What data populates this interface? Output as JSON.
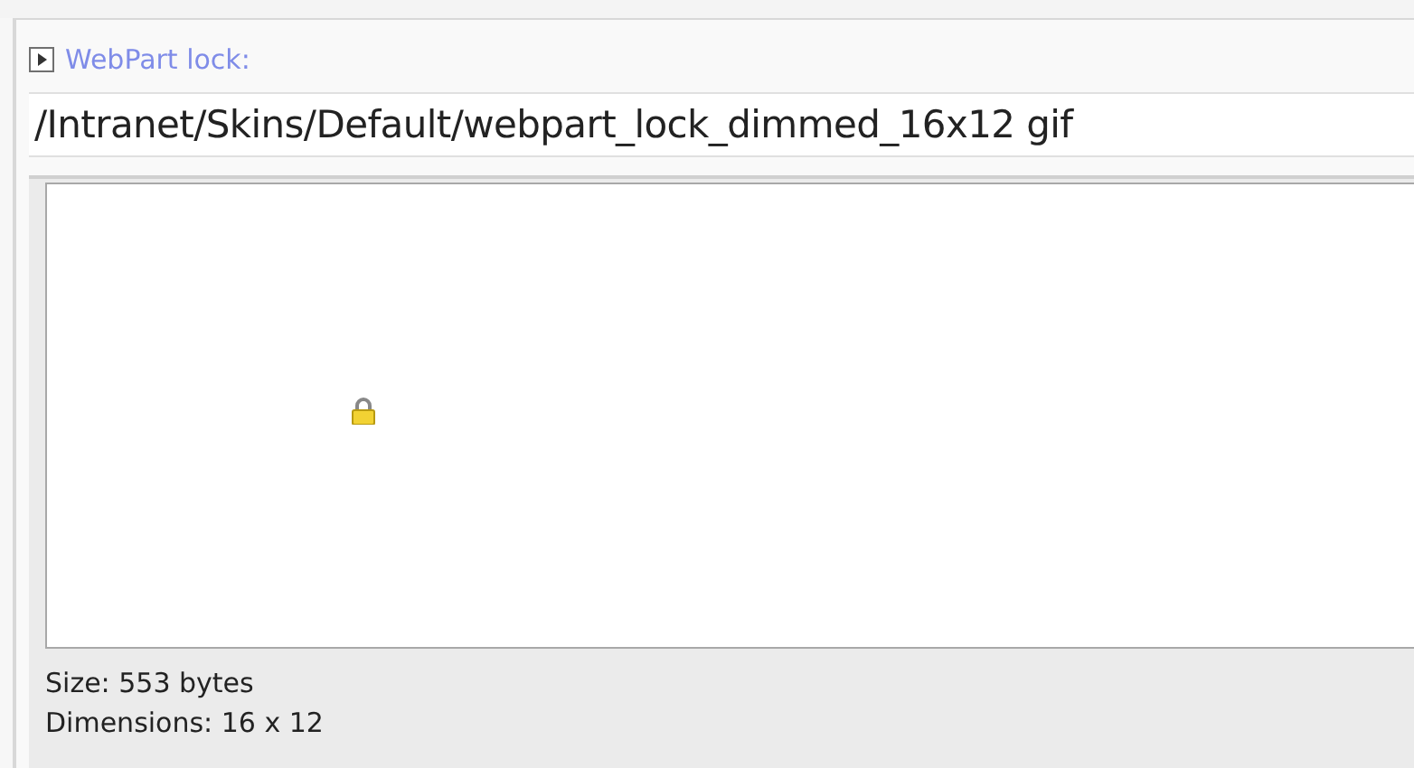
{
  "property": {
    "label": "WebPart lock:"
  },
  "path_field": {
    "value": "/Intranet/Skins/Default/webpart_lock_dimmed_16x12 gif"
  },
  "preview": {
    "info": [
      "Size: 553 bytes",
      "Dimensions: 16 x 12"
    ]
  }
}
